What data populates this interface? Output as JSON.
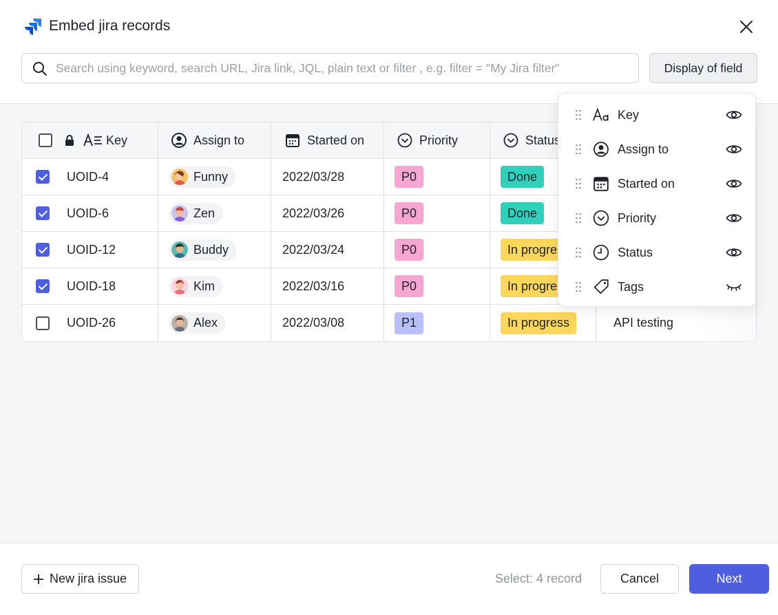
{
  "dialog": {
    "title": "Embed jira records",
    "search_placeholder": "Search using keyword, search URL, Jira link, JQL, plain text or filter , e.g. filter = \"My Jira filter\"",
    "display_button": "Display of field"
  },
  "columns": {
    "key": "Key",
    "assign": "Assign to",
    "started": "Started on",
    "priority": "Priority",
    "status": "Status"
  },
  "rows": [
    {
      "key": "UOID-4",
      "checked": true,
      "assignee": "Funny",
      "started": "2022/03/28",
      "priority": "P0",
      "status": "Done",
      "tags": ""
    },
    {
      "key": "UOID-6",
      "checked": true,
      "assignee": "Zen",
      "started": "2022/03/26",
      "priority": "P0",
      "status": "Done",
      "tags": ""
    },
    {
      "key": "UOID-12",
      "checked": true,
      "assignee": "Buddy",
      "started": "2022/03/24",
      "priority": "P0",
      "status": "In progress",
      "tags": ""
    },
    {
      "key": "UOID-18",
      "checked": true,
      "assignee": "Kim",
      "started": "2022/03/16",
      "priority": "P0",
      "status": "In progress",
      "tags": ""
    },
    {
      "key": "UOID-26",
      "checked": false,
      "assignee": "Alex",
      "started": "2022/03/08",
      "priority": "P1",
      "status": "In progress",
      "tags": "API testing"
    }
  ],
  "field_menu": [
    {
      "label": "Key",
      "icon": "text-field-icon",
      "visible": true
    },
    {
      "label": "Assign to",
      "icon": "person-icon",
      "visible": true
    },
    {
      "label": "Started on",
      "icon": "calendar-icon",
      "visible": true
    },
    {
      "label": "Priority",
      "icon": "chevron-circle-icon",
      "visible": true
    },
    {
      "label": "Status",
      "icon": "clock-icon",
      "visible": true
    },
    {
      "label": "Tags",
      "icon": "tag-icon",
      "visible": false
    }
  ],
  "footer": {
    "new_issue": "New jira issue",
    "selection": "Select: 4 record",
    "cancel": "Cancel",
    "next": "Next"
  },
  "colors": {
    "accent": "#4e5ee0",
    "p0": "#f7a6d3",
    "p1": "#b9c0f9",
    "done": "#2fd1bb",
    "in_progress": "#fcd75c"
  }
}
